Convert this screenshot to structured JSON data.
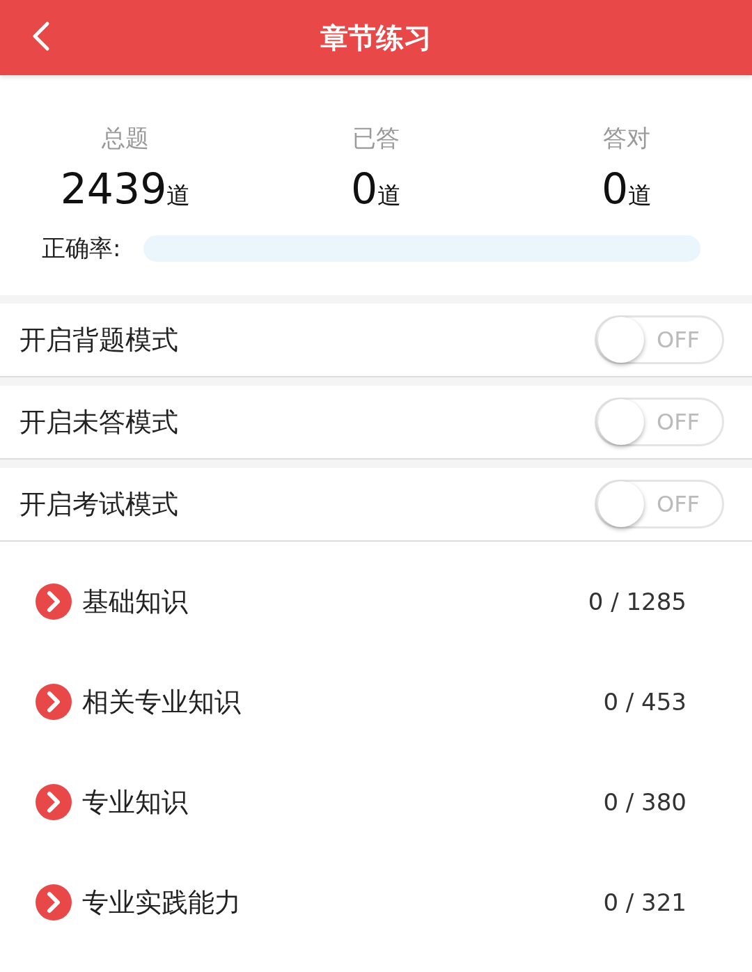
{
  "header": {
    "title": "章节练习"
  },
  "stats": [
    {
      "label": "总题",
      "value": "2439",
      "unit": "道"
    },
    {
      "label": "已答",
      "value": "0",
      "unit": "道"
    },
    {
      "label": "答对",
      "value": "0",
      "unit": "道"
    }
  ],
  "accuracy": {
    "label": "正确率:",
    "level": 0
  },
  "modes": [
    {
      "label": "开启背题模式",
      "on": false,
      "state_text": "OFF"
    },
    {
      "label": "开启未答模式",
      "on": false,
      "state_text": "OFF"
    },
    {
      "label": "开启考试模式",
      "on": false,
      "state_text": "OFF"
    }
  ],
  "chapters": [
    {
      "name": "基础知识",
      "progress": "0 / 1285"
    },
    {
      "name": "相关专业知识",
      "progress": "0 / 453"
    },
    {
      "name": "专业知识",
      "progress": "0 / 380"
    },
    {
      "name": "专业实践能力",
      "progress": "0 / 321"
    }
  ]
}
